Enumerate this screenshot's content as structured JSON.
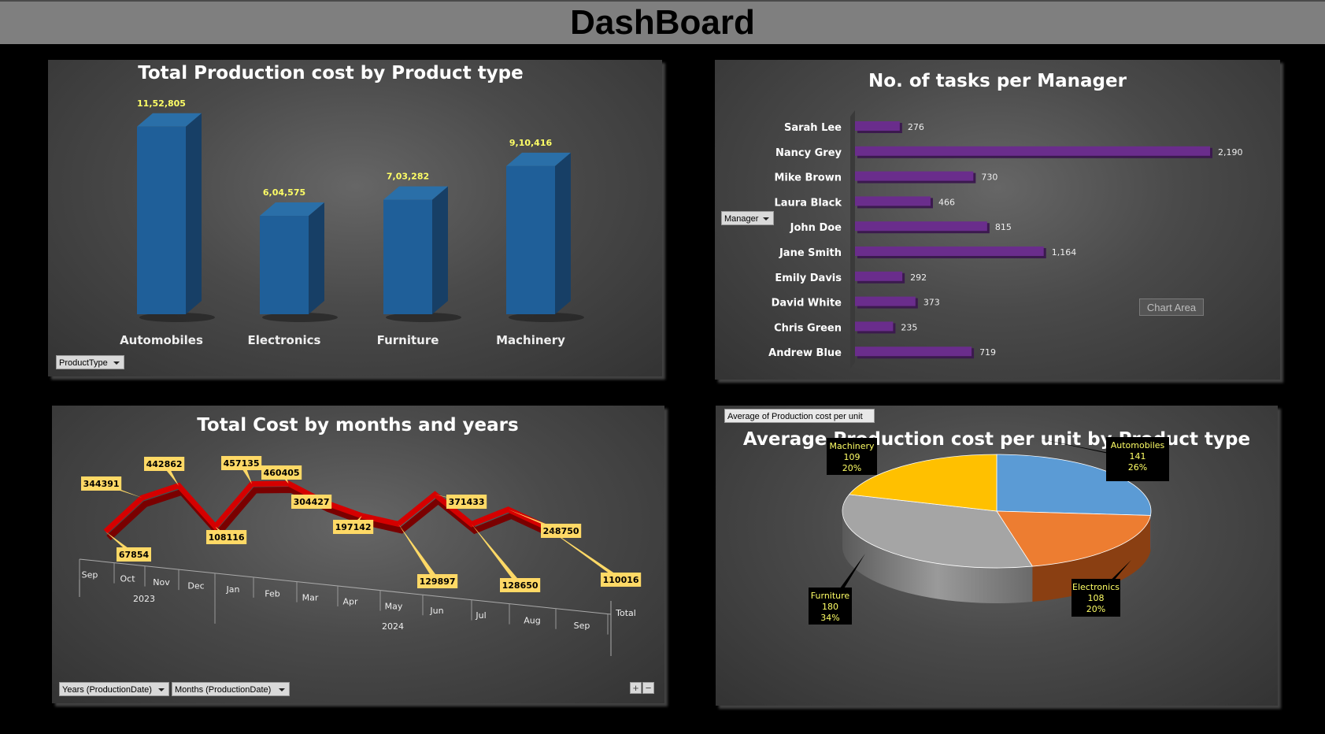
{
  "dashboard_title": "DashBoard",
  "bar_panel": {
    "title": "Total Production cost by Product type",
    "filter_label": "ProductType"
  },
  "hbar_panel": {
    "title": "No. of tasks per Manager",
    "filter_label": "Manager",
    "chart_area_label": "Chart Area"
  },
  "line_panel": {
    "title": "Total Cost by months and years",
    "filter_years": "Years (ProductionDate)",
    "filter_months": "Months (ProductionDate)",
    "plus": "+",
    "minus": "−"
  },
  "pie_panel": {
    "title": "Average Production cost per unit by Product type",
    "field_label": "Average of Production cost per unit"
  },
  "colors": {
    "bar": "#1f5f99",
    "hbar": "#6a2d8c",
    "line": "#d50000",
    "label_yellow": "#ffff66",
    "callout_fill": "#ffd966"
  },
  "chart_data": [
    {
      "type": "bar",
      "title": "Total Production cost by Product type",
      "categories": [
        "Automobiles",
        "Electronics",
        "Furniture",
        "Machinery"
      ],
      "values": [
        1152805,
        604575,
        703282,
        910416
      ],
      "value_labels": [
        "11,52,805",
        "6,04,575",
        "7,03,282",
        "9,10,416"
      ],
      "ylim": [
        0,
        1200000
      ],
      "grid": false,
      "legend": "none"
    },
    {
      "type": "bar",
      "orientation": "horizontal",
      "title": "No. of tasks per Manager",
      "categories": [
        "Sarah Lee",
        "Nancy Grey",
        "Mike Brown",
        "Laura Black",
        "John Doe",
        "Jane Smith",
        "Emily Davis",
        "David White",
        "Chris Green",
        "Andrew Blue"
      ],
      "values": [
        276,
        2190,
        730,
        466,
        815,
        1164,
        292,
        373,
        235,
        719
      ],
      "value_labels": [
        "276",
        "2,190",
        "730",
        "466",
        "815",
        "1,164",
        "292",
        "373",
        "235",
        "719"
      ],
      "xlim": [
        0,
        2500
      ],
      "grid": false,
      "legend": "none"
    },
    {
      "type": "line",
      "title": "Total Cost by months and years",
      "categories": [
        "Sep",
        "Oct",
        "Nov",
        "Dec",
        "Jan",
        "Feb",
        "Mar",
        "Apr",
        "May",
        "Jun",
        "Jul",
        "Aug",
        "Sep"
      ],
      "groups": [
        {
          "label": "2023",
          "months": [
            "Sep",
            "Oct",
            "Nov",
            "Dec"
          ]
        },
        {
          "label": "2024",
          "months": [
            "Jan",
            "Feb",
            "Mar",
            "Apr",
            "May",
            "Jun",
            "Jul",
            "Aug",
            "Sep"
          ]
        }
      ],
      "total_label": "Total",
      "values": [
        67854,
        344391,
        442862,
        108116,
        457135,
        460405,
        304427,
        197142,
        129897,
        371433,
        128650,
        248750,
        110016
      ],
      "ylim": [
        0,
        500000
      ],
      "grid": false,
      "legend": "none"
    },
    {
      "type": "pie",
      "title": "Average Production cost per unit by Product type",
      "categories": [
        "Automobiles",
        "Electronics",
        "Furniture",
        "Machinery"
      ],
      "values": [
        141,
        108,
        180,
        109
      ],
      "percents": [
        "26%",
        "20%",
        "34%",
        "20%"
      ],
      "colors": [
        "#5b9bd5",
        "#ed7d31",
        "#a5a5a5",
        "#ffc000"
      ],
      "legend": "none"
    }
  ]
}
